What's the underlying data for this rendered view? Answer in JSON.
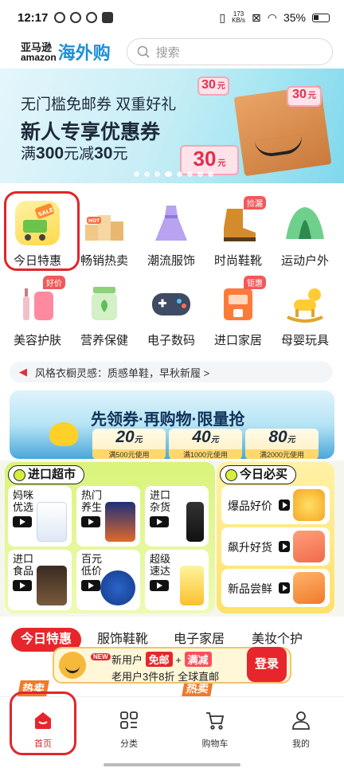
{
  "status": {
    "time": "12:17",
    "net_speed": "173",
    "net_unit": "KB/s",
    "battery": "35%"
  },
  "header": {
    "logo_cn": "亚马逊",
    "logo_en": "amazon",
    "logo_brand": "海外购",
    "search_placeholder": "搜索"
  },
  "banner": {
    "line1": "无门槛免邮券 双重好礼",
    "line2": "新人专享优惠券",
    "line3_prefix": "满",
    "line3_a": "300",
    "line3_mid": "元减",
    "line3_b": "30",
    "line3_suffix": "元",
    "tag_value": "30",
    "tag_unit": "元",
    "sale_tag": "SALE",
    "hot_tag": "HOT"
  },
  "categories": [
    {
      "label": "今日特惠",
      "icon": "sale-cart-icon"
    },
    {
      "label": "畅销热卖",
      "icon": "podium-icon"
    },
    {
      "label": "潮流服饰",
      "icon": "dress-icon"
    },
    {
      "label": "时尚鞋靴",
      "icon": "boot-icon",
      "badge": "捡漏"
    },
    {
      "label": "运动户外",
      "icon": "tent-icon"
    },
    {
      "label": "美容护肤",
      "icon": "skincare-icon",
      "badge": "好价"
    },
    {
      "label": "营养保健",
      "icon": "supplement-icon"
    },
    {
      "label": "电子数码",
      "icon": "gamepad-icon"
    },
    {
      "label": "进口家居",
      "icon": "coffee-machine-icon",
      "badge": "钜惠"
    },
    {
      "label": "母婴玩具",
      "icon": "rocking-horse-icon"
    }
  ],
  "marquee": "风格衣橱灵感：质感单鞋，早秋新履 >",
  "promo": {
    "title": "先领券·再购物·限量抢",
    "coupons": [
      {
        "value": "20",
        "cond": "满500元使用"
      },
      {
        "value": "40",
        "cond": "满1000元使用"
      },
      {
        "value": "80",
        "cond": "满2000元使用"
      }
    ],
    "unit": "元"
  },
  "import_market": {
    "title": "进口超市",
    "tiles": [
      {
        "line1": "妈咪",
        "line2": "优选"
      },
      {
        "line1": "热门",
        "line2": "养生"
      },
      {
        "line1": "进口",
        "line2": "杂货"
      },
      {
        "line1": "进口",
        "line2": "食品"
      },
      {
        "line1": "百元",
        "line2": "低价"
      },
      {
        "line1": "超级",
        "line2": "速达"
      }
    ]
  },
  "must_buy": {
    "title": "今日必买",
    "items": [
      {
        "label": "爆品好价"
      },
      {
        "label": "飙升好货"
      },
      {
        "label": "新品尝鲜"
      }
    ]
  },
  "tabs": [
    {
      "label": "今日特惠",
      "active": true
    },
    {
      "label": "服饰鞋靴"
    },
    {
      "label": "电子家居"
    },
    {
      "label": "美妆个护"
    }
  ],
  "float_promo": {
    "new_tag": "NEW",
    "line1_a": "新用户",
    "line1_b": "免邮",
    "line1_plus": "+",
    "line1_c": "满减",
    "line2": "老用户3件8折 全球直邮",
    "login": "登录"
  },
  "peek": {
    "left": "热卖",
    "right": "热卖"
  },
  "tabbar": [
    {
      "label": "首页",
      "icon": "home-icon",
      "active": true
    },
    {
      "label": "分类",
      "icon": "category-icon"
    },
    {
      "label": "购物车",
      "icon": "cart-icon"
    },
    {
      "label": "我的",
      "icon": "profile-icon"
    }
  ],
  "colors": {
    "accent": "#e6262c",
    "brand_blue": "#1e8fd6",
    "lime": "#d7ee3c"
  }
}
